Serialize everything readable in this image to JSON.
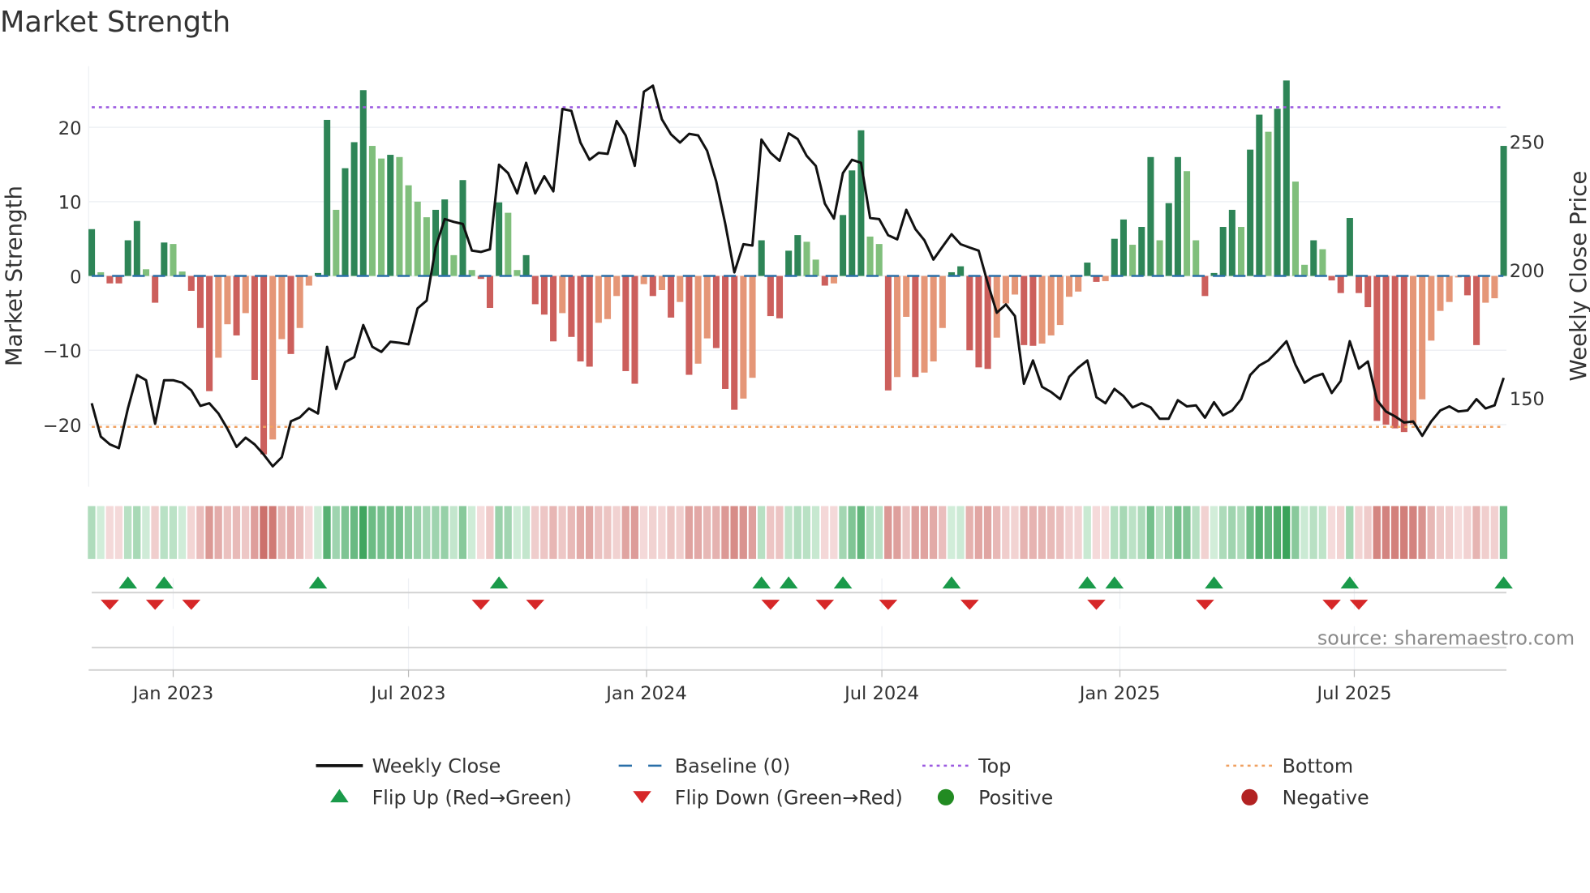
{
  "chart_data": {
    "type": "bar",
    "title": "Market Strength",
    "ylabel": "Market Strength",
    "y2label": "Weekly Close Price",
    "ylim": [
      -28,
      28
    ],
    "y2lim": [
      117,
      278
    ],
    "y_ticks": [
      {
        "v": 20,
        "label": "20"
      },
      {
        "v": 10,
        "label": "10"
      },
      {
        "v": 0,
        "label": "0"
      },
      {
        "v": -10,
        "label": "−10"
      },
      {
        "v": -20,
        "label": "−20"
      }
    ],
    "y2_ticks": [
      {
        "v": 250,
        "label": "250"
      },
      {
        "v": 200,
        "label": "200"
      },
      {
        "v": 150,
        "label": "150"
      }
    ],
    "x_ticks": [
      {
        "week": 9,
        "label": "Jan 2023"
      },
      {
        "week": 35,
        "label": "Jul 2023"
      },
      {
        "week": 61.3,
        "label": "Jan 2024"
      },
      {
        "week": 87.3,
        "label": "Jul 2024"
      },
      {
        "week": 113.6,
        "label": "Jan 2025"
      },
      {
        "week": 139.5,
        "label": "Jul 2025"
      }
    ],
    "top_level": 22.7,
    "bottom_level": -20.3,
    "strength": [
      6.3,
      0.5,
      -1,
      -1,
      4.8,
      7.4,
      0.9,
      -3.6,
      4.5,
      4.3,
      0.6,
      -2,
      -7,
      -15.5,
      -11,
      -6.5,
      -8,
      -5,
      -14,
      -24,
      -22,
      -8.5,
      -10.5,
      -7,
      -1.3,
      0.4,
      21,
      8.9,
      14.5,
      18,
      25,
      17.5,
      15.8,
      16.3,
      16,
      12.2,
      10,
      7.9,
      8.9,
      10.3,
      2.8,
      12.9,
      0.8,
      -0.4,
      -4.3,
      9.9,
      8.5,
      0.8,
      2.8,
      -3.8,
      -5.2,
      -8.8,
      -5,
      -8.2,
      -11.5,
      -12.2,
      -6.3,
      -5.8,
      -2.7,
      -12.8,
      -14.5,
      -1.1,
      -2.7,
      -1.9,
      -5.6,
      -3.5,
      -13.3,
      -11.8,
      -8.4,
      -9.7,
      -15.2,
      -18,
      -16.5,
      -13.7,
      4.8,
      -5.4,
      -5.7,
      3.4,
      5.5,
      4.6,
      2.2,
      -1.3,
      -1,
      8.2,
      14.2,
      19.6,
      5.3,
      4.3,
      -15.4,
      -13.6,
      -5.5,
      -13.6,
      -13,
      -11.5,
      -7,
      0.5,
      1.3,
      -10,
      -12.3,
      -12.5,
      -8.3,
      -3.7,
      -2.5,
      -9.3,
      -9.4,
      -9.1,
      -8,
      -6.6,
      -2.8,
      -2.1,
      1.8,
      -0.8,
      -0.7,
      5,
      7.6,
      4.2,
      6.6,
      16,
      4.8,
      9.8,
      16,
      14.1,
      4.8,
      -2.7,
      0.4,
      6.6,
      8.9,
      6.6,
      17,
      21.7,
      19.4,
      22.5,
      26.3,
      12.7,
      1.5,
      4.8,
      3.6,
      -0.6,
      -2.3,
      7.8,
      -2.3,
      -4.2,
      -19.5,
      -20,
      -20.5,
      -21,
      -20,
      -16.6,
      -8.7,
      -4.7,
      -3.5,
      -0.2,
      -2.6,
      -9.3,
      -3.6,
      -3,
      17.5
    ],
    "shade": "DLRRDDLRDLLRRRSSRSRRSSRSSDDLDDDLLDLLLLDDLDLRRDLLDRRRSRRRSSSRRSRSRSRSSRRRSSDRRDDLLRSDDDLLRSSRSSSDDRRRSSSRRSSSSSDRSDDLDDLDDLLRDDDLDDLDDLLDLRRDRRRRRRSSSSSSRRSSD",
    "weekly_close": [
      148,
      135,
      132,
      130.5,
      146,
      159,
      157,
      140,
      157,
      157,
      156,
      153,
      147,
      148,
      144,
      138,
      131,
      134.6,
      132,
      128,
      123.4,
      127,
      141,
      142.5,
      146,
      144,
      170,
      153.6,
      164,
      166,
      178.5,
      170,
      168,
      172,
      171.6,
      171,
      185,
      188,
      208.7,
      219.8,
      218.7,
      217.9,
      207.5,
      207,
      208,
      241,
      237.7,
      229.8,
      241.7,
      229.8,
      236.5,
      230.6,
      262.7,
      262,
      249.6,
      242.9,
      245.6,
      245.2,
      258,
      252.4,
      240.5,
      269.4,
      271.8,
      258.7,
      252.8,
      249.6,
      253,
      252.4,
      246.4,
      234.5,
      217.9,
      199,
      210,
      209.5,
      250.8,
      245.6,
      242.5,
      253.2,
      251,
      244.4,
      240.5,
      225.8,
      220,
      237.7,
      242.9,
      241.7,
      220.2,
      219.8,
      213.5,
      211.9,
      223.4,
      215.9,
      211.5,
      204,
      209,
      213.9,
      210,
      208.7,
      207.5,
      194.8,
      183.3,
      186.5,
      182,
      155.6,
      164.7,
      154.4,
      152.4,
      149.6,
      158.3,
      161.9,
      164.7,
      150.4,
      148,
      153.6,
      150.8,
      146.4,
      148,
      146.4,
      142,
      142,
      149.2,
      146.8,
      147.2,
      142.4,
      148.4,
      143.3,
      145.2,
      149.6,
      159,
      162.7,
      164.7,
      168.3,
      172.2,
      163,
      156,
      158.3,
      159.5,
      152,
      156.7,
      172.2,
      161.5,
      164.3,
      149.2,
      144.8,
      142.9,
      140.5,
      140.9,
      135.3,
      140.9,
      145.2,
      146.8,
      144.8,
      145.2,
      149.6,
      146,
      147.2,
      157.9
    ],
    "flip_up_weeks": [
      4,
      8,
      25,
      45,
      74,
      77,
      83,
      95,
      110,
      113,
      124,
      139,
      156
    ],
    "flip_down_weeks": [
      2,
      7,
      11,
      43,
      49,
      75,
      81,
      88,
      97,
      111,
      123,
      137,
      140
    ],
    "colors": {
      "dark_green": "#2e8557",
      "light_green": "#80bf7c",
      "red": "#cc5f5c",
      "salmon": "#e59677",
      "line": "#111111",
      "baseline": "#2a6fa8",
      "top": "#9b59e0",
      "bottom": "#f0a060",
      "flip_up": "#1a9a4a",
      "flip_down": "#d62728",
      "positive": "#228b22",
      "negative": "#b22222"
    },
    "legend": [
      {
        "key": "line",
        "label": "Weekly Close"
      },
      {
        "key": "baseline",
        "label": "Baseline (0)"
      },
      {
        "key": "top",
        "label": "Top"
      },
      {
        "key": "bottom",
        "label": "Bottom"
      },
      {
        "key": "flip_up",
        "label": "Flip Up (Red→Green)"
      },
      {
        "key": "flip_down",
        "label": "Flip Down (Green→Red)"
      },
      {
        "key": "positive",
        "label": "Positive"
      },
      {
        "key": "negative",
        "label": "Negative"
      }
    ],
    "legend_position": "bottom",
    "source": "source: sharemaestro.com"
  }
}
